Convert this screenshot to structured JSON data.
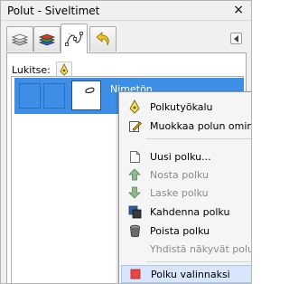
{
  "window": {
    "title": "Polut - Siveltimet",
    "close_glyph": "×"
  },
  "tabs": [
    {
      "icon": "layers-icon"
    },
    {
      "icon": "channels-icon"
    },
    {
      "icon": "paths-icon",
      "active": true
    },
    {
      "icon": "undo-history-icon"
    }
  ],
  "lock": {
    "label": "Lukitse:"
  },
  "paths": [
    {
      "name": "Nimetön",
      "selected": true
    }
  ],
  "context_menu": {
    "items": [
      {
        "label": "Polkutyökalu",
        "icon": "path-tool-icon",
        "enabled": true
      },
      {
        "label": "Muokkaa polun ominaisuuksia",
        "icon": "edit-attributes-icon",
        "enabled": true
      },
      {
        "label": "Uusi polku...",
        "icon": "new-page-icon",
        "enabled": true
      },
      {
        "label": "Nosta polku",
        "icon": "arrow-up-icon",
        "enabled": false
      },
      {
        "label": "Laske polku",
        "icon": "arrow-down-icon",
        "enabled": false
      },
      {
        "label": "Kahdenna polku",
        "icon": "duplicate-icon",
        "enabled": true
      },
      {
        "label": "Poista polku",
        "icon": "trash-icon",
        "enabled": true
      },
      {
        "label": "Yhdistä näkyvät polut",
        "icon": "",
        "enabled": false
      },
      {
        "label": "Polku valinnaksi",
        "icon": "path-to-selection-icon",
        "enabled": true,
        "highlighted": true
      }
    ]
  },
  "colors": {
    "selection": "#3d8ee6",
    "menu_highlight": "#d7e6fb"
  }
}
